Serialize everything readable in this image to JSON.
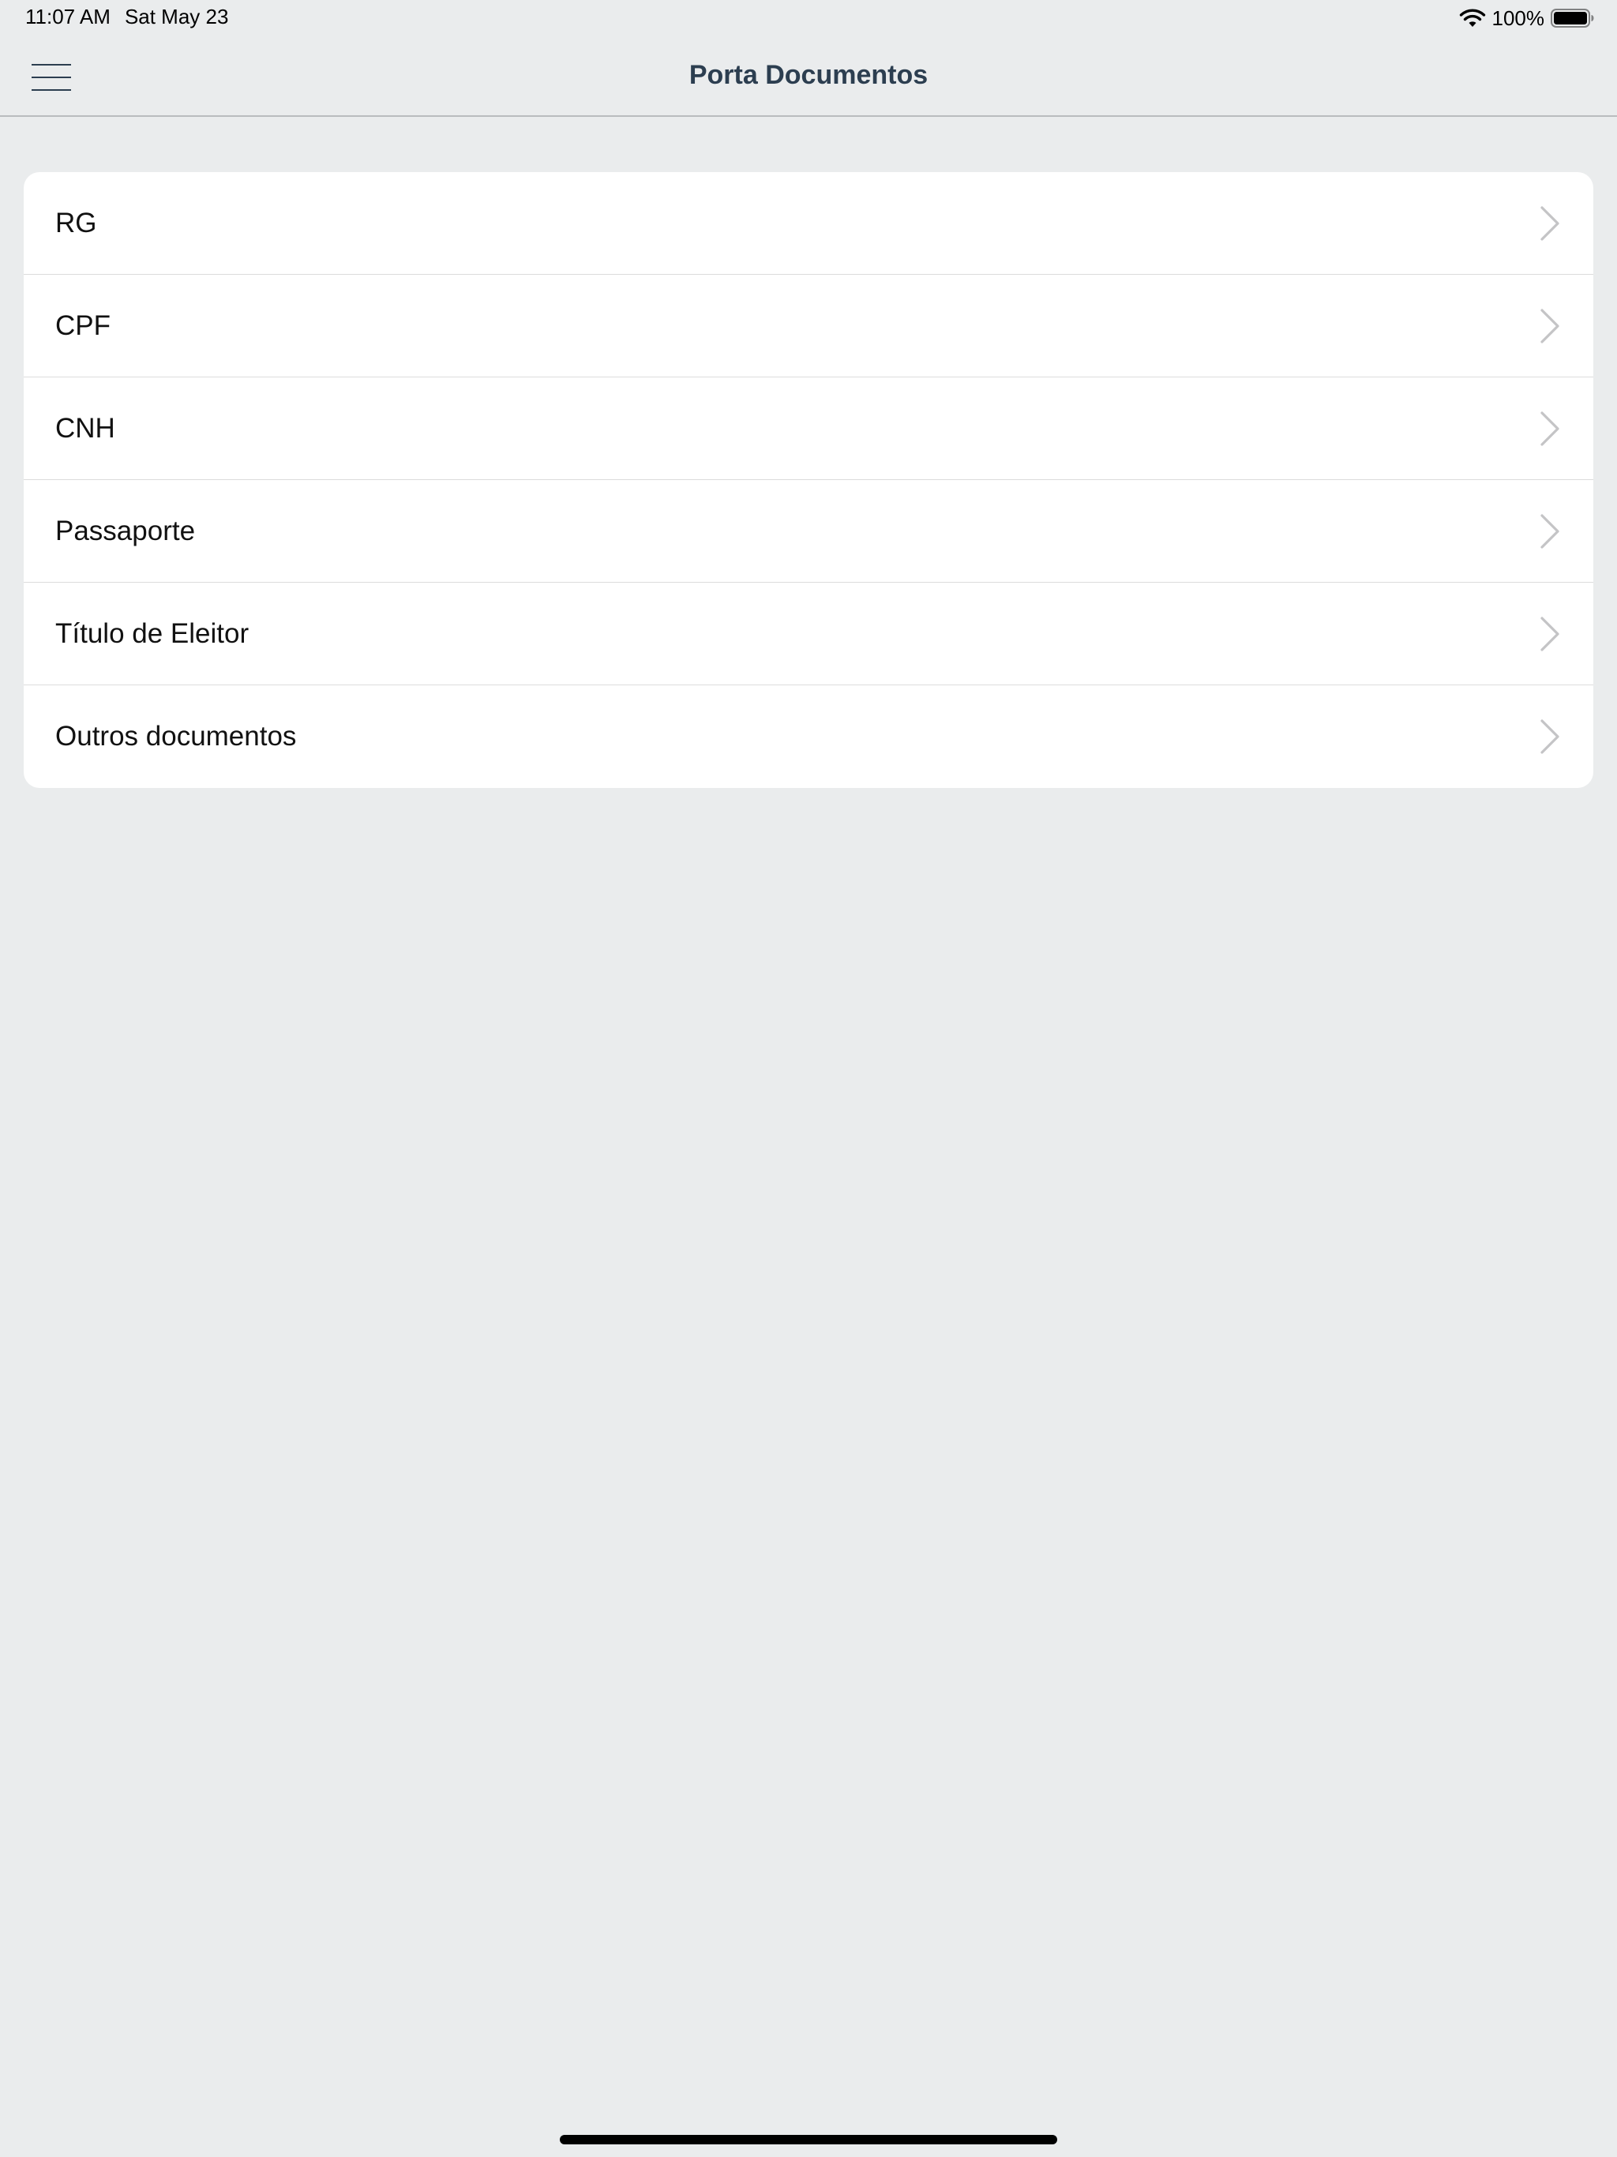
{
  "status_bar": {
    "time": "11:07 AM",
    "date": "Sat May 23",
    "battery_text": "100%",
    "icons": [
      "wifi-icon",
      "battery-icon"
    ]
  },
  "nav": {
    "title": "Porta Documentos",
    "menu_icon": "hamburger-menu-icon",
    "title_color": "#2c3e50"
  },
  "documents": {
    "items": [
      {
        "label": "RG"
      },
      {
        "label": "CPF"
      },
      {
        "label": "CNH"
      },
      {
        "label": "Passaporte"
      },
      {
        "label": "Título de Eleitor"
      },
      {
        "label": "Outros documentos"
      }
    ],
    "chevron_icon": "chevron-right-icon"
  },
  "colors": {
    "background": "#eaeced",
    "card": "#ffffff",
    "chevron": "#c4c4c6"
  }
}
